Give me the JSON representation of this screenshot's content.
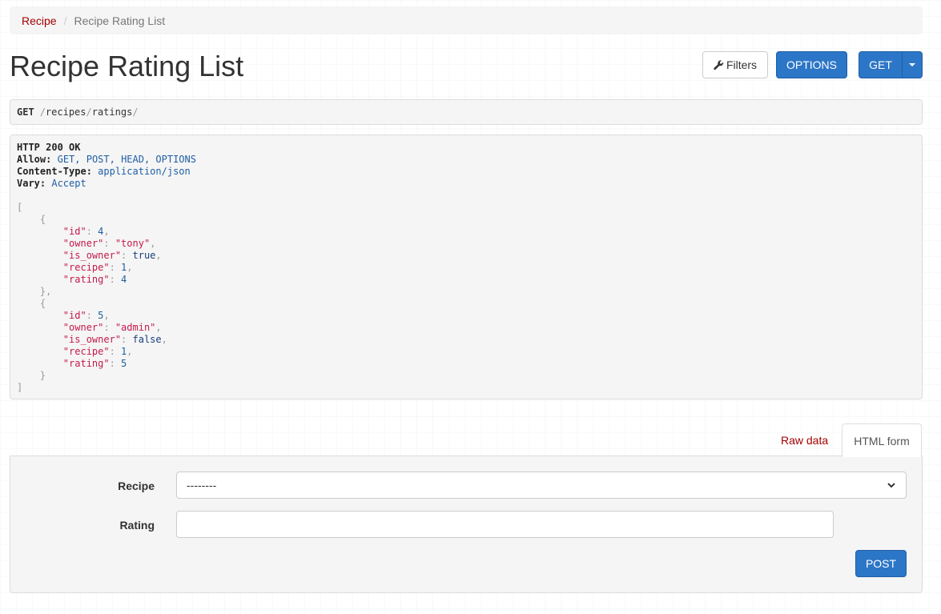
{
  "breadcrumb": {
    "items": [
      "Recipe"
    ],
    "active": "Recipe Rating List",
    "separator": "/"
  },
  "page": {
    "title": "Recipe Rating List"
  },
  "toolbar": {
    "filters_label": "Filters",
    "options_label": "OPTIONS",
    "get_label": "GET"
  },
  "request": {
    "method": "GET",
    "path_parts": [
      "recipes",
      "ratings"
    ]
  },
  "response": {
    "status": "HTTP 200 OK",
    "headers": [
      {
        "name": "Allow:",
        "value": "GET, POST, HEAD, OPTIONS"
      },
      {
        "name": "Content-Type:",
        "value": "application/json"
      },
      {
        "name": "Vary:",
        "value": "Accept"
      }
    ],
    "items": [
      {
        "id": "4",
        "owner": "\"tony\"",
        "is_owner": "true",
        "recipe": "1",
        "rating": "4"
      },
      {
        "id": "5",
        "owner": "\"admin\"",
        "is_owner": "false",
        "recipe": "1",
        "rating": "5"
      }
    ],
    "keys": {
      "id": "\"id\"",
      "owner": "\"owner\"",
      "is_owner": "\"is_owner\"",
      "recipe": "\"recipe\"",
      "rating": "\"rating\""
    }
  },
  "form_tabs": {
    "raw_data": "Raw data",
    "html_form": "HTML form"
  },
  "form": {
    "recipe_label": "Recipe",
    "recipe_value": "--------",
    "rating_label": "Rating",
    "rating_value": "",
    "submit_label": "POST"
  },
  "colors": {
    "primary": "#2c76c7",
    "link": "#a30000"
  }
}
